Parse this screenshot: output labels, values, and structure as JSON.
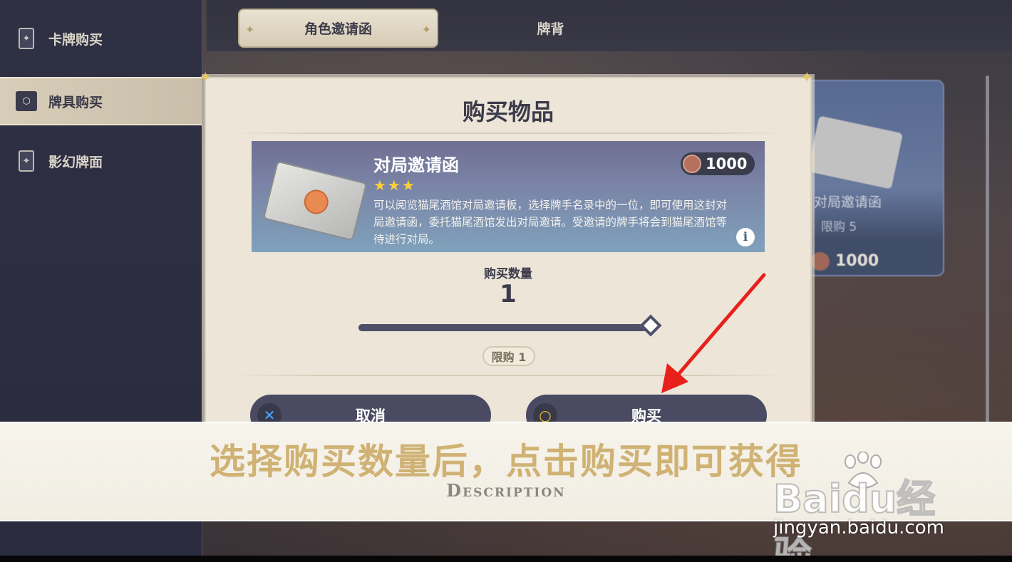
{
  "sidebar": {
    "items": [
      {
        "label": "卡牌购买",
        "icon": "card-icon",
        "active": false
      },
      {
        "label": "牌具购买",
        "icon": "card-box-icon",
        "active": true
      },
      {
        "label": "影幻牌面",
        "icon": "card-icon",
        "active": false
      }
    ]
  },
  "tabs": [
    {
      "label": "角色邀请函",
      "active": true
    },
    {
      "label": "牌背",
      "active": false
    }
  ],
  "background_card": {
    "name": "对局邀请函",
    "limit": "限购 5",
    "price": "1000"
  },
  "dialog": {
    "title": "购买物品",
    "item": {
      "name": "对局邀请函",
      "stars": "★★★",
      "description": "可以阅览猫尾酒馆对局邀请板，选择牌手名录中的一位，即可使用这封对局邀请函，委托猫尾酒馆发出对局邀请。受邀请的牌手将会到猫尾酒馆等待进行对局。",
      "price": "1000",
      "info_icon": "i"
    },
    "quantity_label": "购买数量",
    "quantity_value": "1",
    "slider_fraction": 1.0,
    "limit_badge": "限购 1",
    "cancel_label": "取消",
    "cancel_icon": "✕",
    "buy_label": "购买",
    "buy_icon": "○"
  },
  "caption": {
    "main": "选择购买数量后，点击购买即可获得",
    "sub": "Description"
  },
  "watermark": {
    "logo": "Baidu经验",
    "url": "jingyan.baidu.com"
  },
  "colors": {
    "annotation_arrow": "#e8201c",
    "caption_gold": "#cfb274",
    "dialog_bg": "#ece5d8",
    "button_bg": "#4a4a62"
  }
}
